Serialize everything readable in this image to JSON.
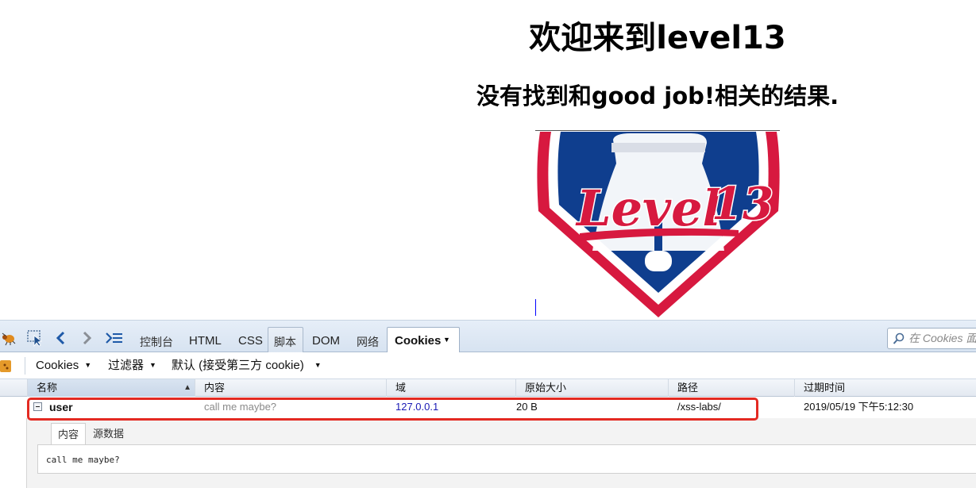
{
  "page": {
    "heading": "欢迎来到level13",
    "result_text": "没有找到和good job!相关的结果.",
    "logo_text": "Level 13",
    "logo_colors": {
      "red": "#D7193F",
      "blue": "#0F3E8E",
      "white": "#FFFFFF"
    }
  },
  "devtools": {
    "tabs": [
      "控制台",
      "HTML",
      "CSS",
      "脚本",
      "DOM",
      "网络",
      "Cookies"
    ],
    "active_tab": "Cookies",
    "search_placeholder": "在 Cookies 面",
    "toolbar": {
      "cookies_menu": "Cookies",
      "filter_menu": "过滤器",
      "default_menu": "默认 (接受第三方 cookie)"
    },
    "table": {
      "columns": [
        "名称",
        "内容",
        "域",
        "原始大小",
        "路径",
        "过期时间"
      ],
      "rows": [
        {
          "name": "user",
          "content": "call me maybe?",
          "domain": "127.0.0.1",
          "raw_size": "20 B",
          "path": "/xss-labs/",
          "expires": "2019/05/19 下午5:12:30"
        }
      ]
    },
    "detail": {
      "tabs": [
        "内容",
        "源数据"
      ],
      "content": "call me maybe?"
    },
    "colors": {
      "highlight": "#E32A22",
      "domain_link": "#1A1AB5",
      "content_gray": "#8A8A8A"
    }
  }
}
